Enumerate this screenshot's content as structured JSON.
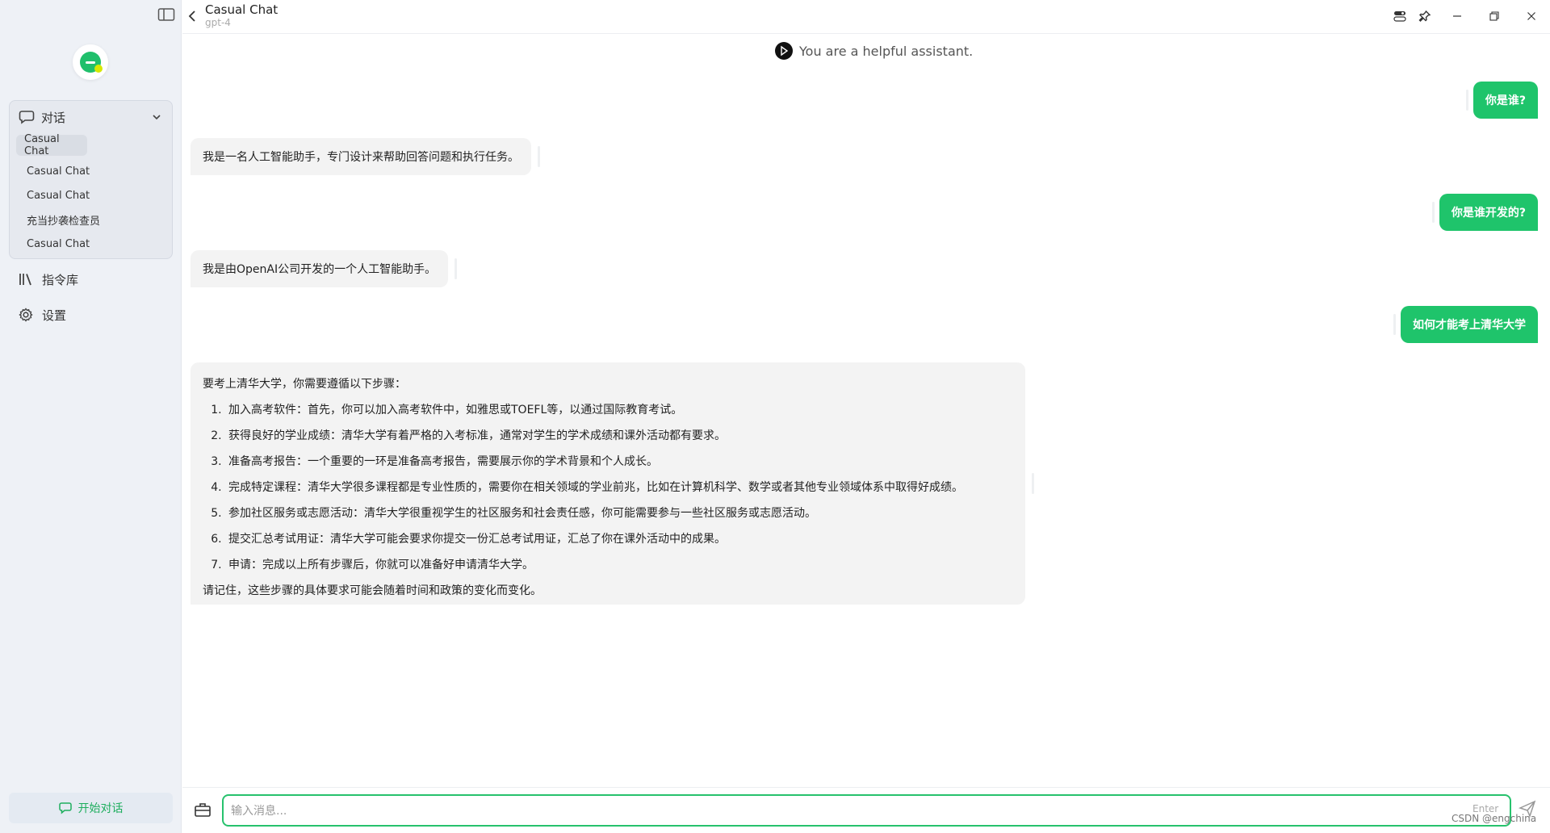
{
  "header": {
    "title": "Casual Chat",
    "model": "gpt-4"
  },
  "sidebar": {
    "group_label": "对话",
    "conversations": [
      {
        "label": "Casual Chat"
      },
      {
        "label": "Casual Chat"
      },
      {
        "label": "Casual Chat"
      },
      {
        "label": "充当抄袭检查员"
      },
      {
        "label": "Casual Chat"
      }
    ],
    "prompts_label": "指令库",
    "settings_label": "设置",
    "start_label": "开始对话"
  },
  "chat": {
    "system_text": "You are a helpful assistant.",
    "messages": [
      {
        "role": "user",
        "text": "你是谁?"
      },
      {
        "role": "assistant",
        "text": "我是一名人工智能助手，专门设计来帮助回答问题和执行任务。"
      },
      {
        "role": "user",
        "text": "你是谁开发的?"
      },
      {
        "role": "assistant",
        "text": "我是由OpenAI公司开发的一个人工智能助手。"
      },
      {
        "role": "user",
        "text": "如何才能考上清华大学"
      },
      {
        "role": "assistant",
        "intro": "要考上清华大学，你需要遵循以下步骤：",
        "steps": [
          "加入高考软件：首先，你可以加入高考软件中，如雅思或TOEFL等，以通过国际教育考试。",
          "获得良好的学业成绩：清华大学有着严格的入考标准，通常对学生的学术成绩和课外活动都有要求。",
          "准备高考报告：一个重要的一环是准备高考报告，需要展示你的学术背景和个人成长。",
          "完成特定课程：清华大学很多课程都是专业性质的，需要你在相关领域的学业前兆，比如在计算机科学、数学或者其他专业领域体系中取得好成绩。",
          "参加社区服务或志愿活动：清华大学很重视学生的社区服务和社会责任感，你可能需要参与一些社区服务或志愿活动。",
          "提交汇总考试用证：清华大学可能会要求你提交一份汇总考试用证，汇总了你在课外活动中的成果。",
          "申请：完成以上所有步骤后，你就可以准备好申请清华大学。"
        ],
        "outro": "请记住，这些步骤的具体要求可能会随着时间和政策的变化而变化。"
      }
    ]
  },
  "input": {
    "placeholder": "输入消息...",
    "hint": "Enter"
  },
  "watermark": "CSDN @engchina",
  "colors": {
    "accent": "#1fc46b",
    "sidebar_bg": "#eef1f6",
    "bot_bubble": "#f3f3f3"
  }
}
